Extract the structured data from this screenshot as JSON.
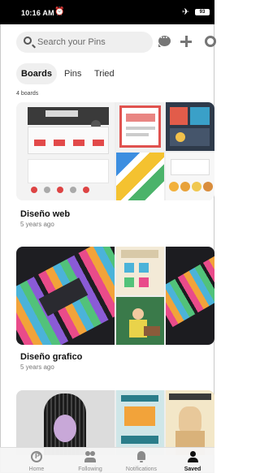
{
  "status_bar": {
    "time": "10:16 AM",
    "alarm_icon": "alarm-clock-icon",
    "airplane_icon": "airplane-mode-icon",
    "battery_level": "93"
  },
  "search": {
    "placeholder": "Search your Pins"
  },
  "header_icons": [
    "chat-bubble-icon",
    "plus-icon",
    "gear-icon"
  ],
  "tabs": [
    {
      "label": "Boards",
      "active": true
    },
    {
      "label": "Pins",
      "active": false
    },
    {
      "label": "Tried",
      "active": false
    }
  ],
  "boards_count": "4 boards",
  "boards": [
    {
      "name": "Diseño web",
      "age": "5 years ago"
    },
    {
      "name": "Diseño grafico",
      "age": "5 years ago"
    }
  ],
  "bottom_nav": [
    {
      "label": "Home",
      "icon": "pinterest-logo-icon",
      "active": false
    },
    {
      "label": "Following",
      "icon": "people-icon",
      "active": false
    },
    {
      "label": "Notifications",
      "icon": "bell-icon",
      "active": false
    },
    {
      "label": "Saved",
      "icon": "person-icon",
      "active": true
    }
  ],
  "colors": {
    "search_bg": "#efefef",
    "active_tab_bg": "#efefef",
    "text_primary": "#111111",
    "text_secondary": "#777777",
    "icon_gray": "#767676"
  }
}
